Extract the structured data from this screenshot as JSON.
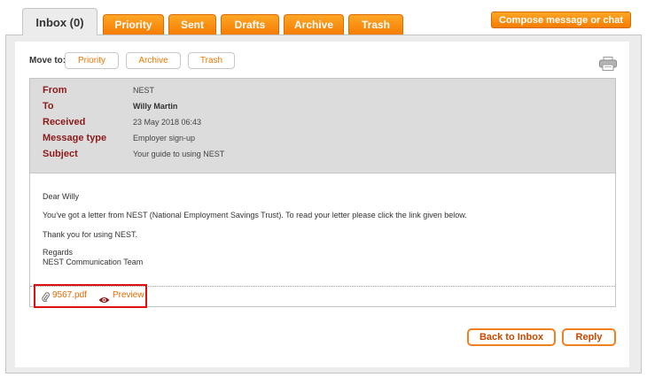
{
  "tabs": [
    {
      "label": "Inbox (0)",
      "active": true
    },
    {
      "label": "Priority",
      "active": false
    },
    {
      "label": "Sent",
      "active": false
    },
    {
      "label": "Drafts",
      "active": false
    },
    {
      "label": "Archive",
      "active": false
    },
    {
      "label": "Trash",
      "active": false
    }
  ],
  "compose_label": "Compose message or chat",
  "move_to": {
    "label": "Move to:",
    "options": [
      "Priority",
      "Archive",
      "Trash"
    ]
  },
  "header": {
    "from_label": "From",
    "from_value": "NEST",
    "to_label": "To",
    "to_value": "Willy Martin",
    "received_label": "Received",
    "received_value": "23 May 2018 06:43",
    "type_label": "Message type",
    "type_value": "Employer sign-up",
    "subject_label": "Subject",
    "subject_value": "Your guide to using NEST"
  },
  "body": {
    "greeting": "Dear Willy",
    "line1": "You've got a letter from NEST (National Employment Savings Trust). To read your letter please click the link given below.",
    "line2": "Thank you for using NEST.",
    "regards": "Regards",
    "signature": "NEST Communication Team"
  },
  "attachment": {
    "file_name": "9567.pdf",
    "preview_label": "Preview"
  },
  "actions": {
    "back_label": "Back to Inbox",
    "reply_label": "Reply"
  },
  "icons": {
    "paperclip": "paperclip-icon",
    "eye": "eye-icon",
    "printer": "printer-icon"
  },
  "colors": {
    "accent": "#f57c00",
    "label": "#8b1a1a",
    "highlight": "#e01010"
  }
}
